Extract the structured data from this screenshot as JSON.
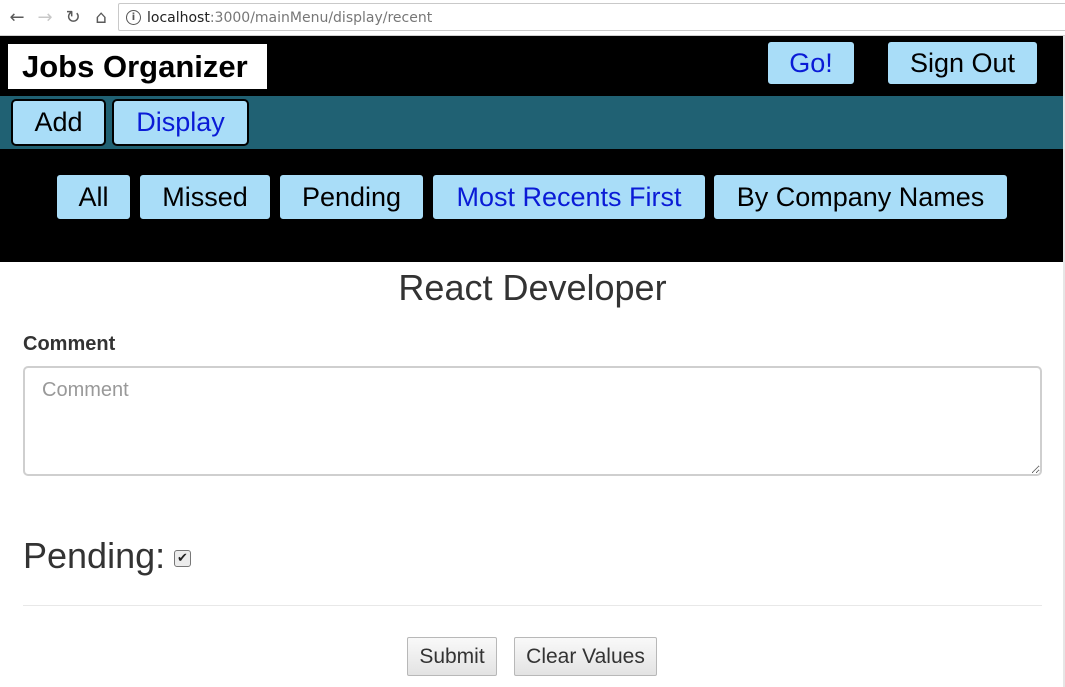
{
  "browser": {
    "url_host": "localhost",
    "url_path": ":3000/mainMenu/display/recent"
  },
  "header": {
    "brand": "Jobs Organizer",
    "go_label": "Go!",
    "signout_label": "Sign Out"
  },
  "subnav": {
    "add_label": "Add",
    "display_label": "Display"
  },
  "filters": {
    "all": "All",
    "missed": "Missed",
    "pending": "Pending",
    "recent": "Most Recents First",
    "company": "By Company Names"
  },
  "form": {
    "job_title": "React Developer",
    "comment_label": "Comment",
    "comment_placeholder": "Comment",
    "comment_value": "",
    "pending_label": "Pending:",
    "pending_checked": true,
    "submit_label": "Submit",
    "clear_label": "Clear Values"
  },
  "colors": {
    "pill_bg": "#a9ddf8",
    "active_text": "#0a1bd6",
    "subnav_bg": "#206173",
    "header_bg": "#000000"
  }
}
